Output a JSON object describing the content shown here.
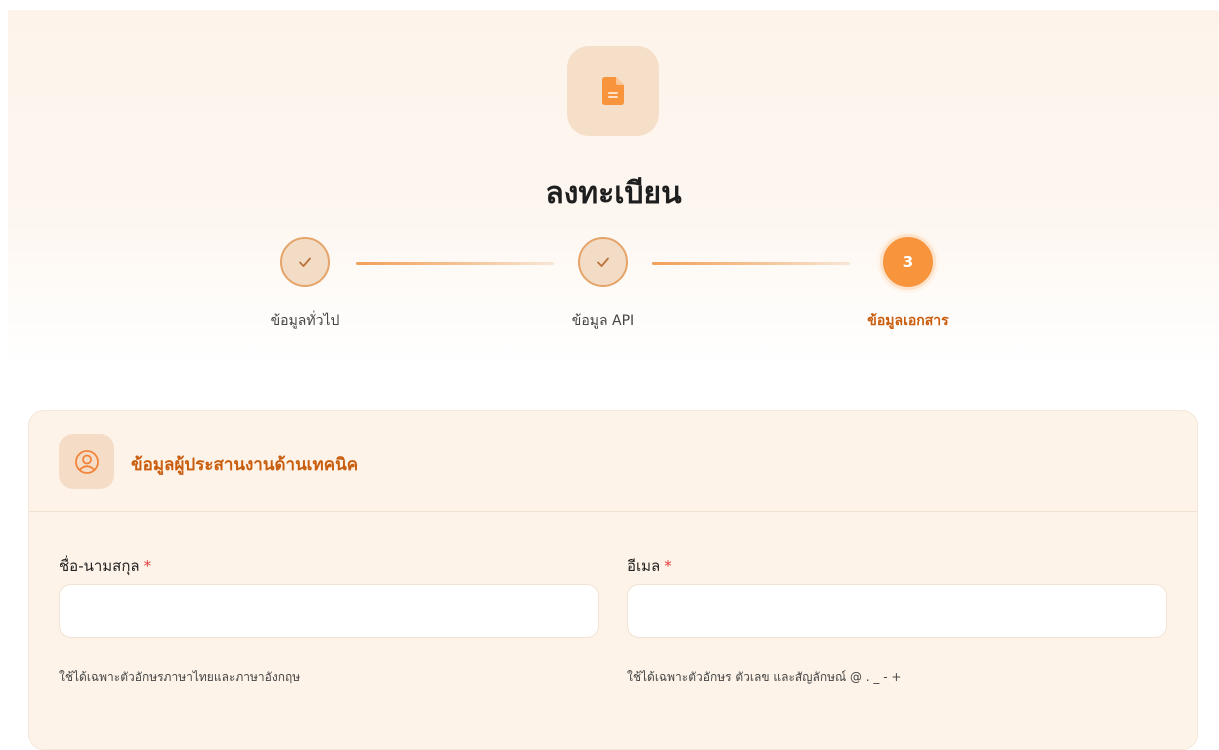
{
  "page": {
    "title": "ลงทะเบียน",
    "header_icon": "document-icon",
    "accent_color": "#f7943c",
    "accent_text_color": "#c95d0d"
  },
  "stepper": {
    "steps": [
      {
        "label": "ข้อมูลทั่วไป",
        "status": "completed",
        "icon": "check-icon"
      },
      {
        "label": "ข้อมูล API",
        "status": "completed",
        "icon": "check-icon"
      },
      {
        "label": "ข้อมูลเอกสาร",
        "status": "active",
        "number": "3"
      }
    ]
  },
  "section": {
    "title": "ข้อมูลผู้ประสานงานด้านเทคนิค",
    "icon": "user-circle-icon"
  },
  "form": {
    "name": {
      "label": "ชื่อ-นามสกุล",
      "required_mark": "*",
      "value": "",
      "hint": "ใช้ได้เฉพาะตัวอักษรภาษาไทยและภาษาอังกฤษ"
    },
    "email": {
      "label": "อีเมล",
      "required_mark": "*",
      "value": "",
      "hint": "ใช้ได้เฉพาะตัวอักษร ตัวเลข และสัญลักษณ์ @ . _ - +"
    }
  }
}
